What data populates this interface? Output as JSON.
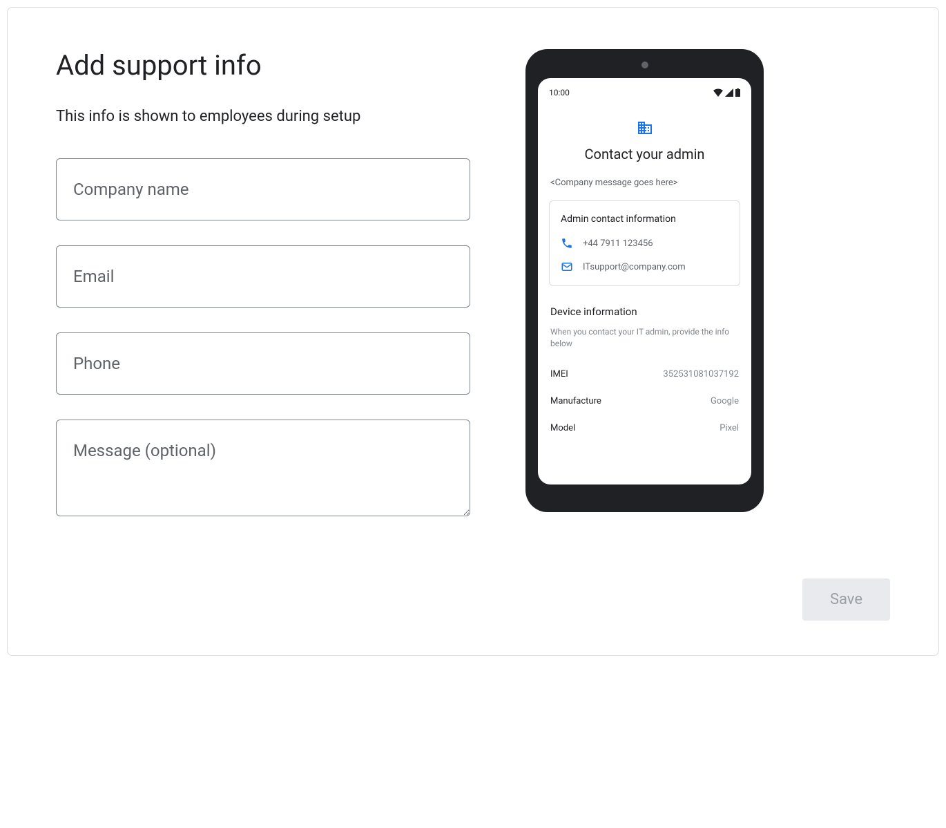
{
  "page": {
    "title": "Add support info",
    "subtitle": "This info is shown to employees during setup"
  },
  "form": {
    "company_placeholder": "Company name",
    "email_placeholder": "Email",
    "phone_placeholder": "Phone",
    "message_placeholder": "Message (optional)"
  },
  "preview": {
    "time": "10:00",
    "contact_title": "Contact your admin",
    "company_message": "<Company message goes here>",
    "admin_card_title": "Admin contact information",
    "phone": "+44 7911 123456",
    "email": "ITsupport@company.com",
    "device_title": "Device information",
    "device_subtitle": "When you contact your IT admin, provide the info below",
    "imei_label": "IMEI",
    "imei_value": "352531081037192",
    "manufacture_label": "Manufacture",
    "manufacture_value": "Google",
    "model_label": "Model",
    "model_value": "Pixel"
  },
  "buttons": {
    "save": "Save"
  }
}
